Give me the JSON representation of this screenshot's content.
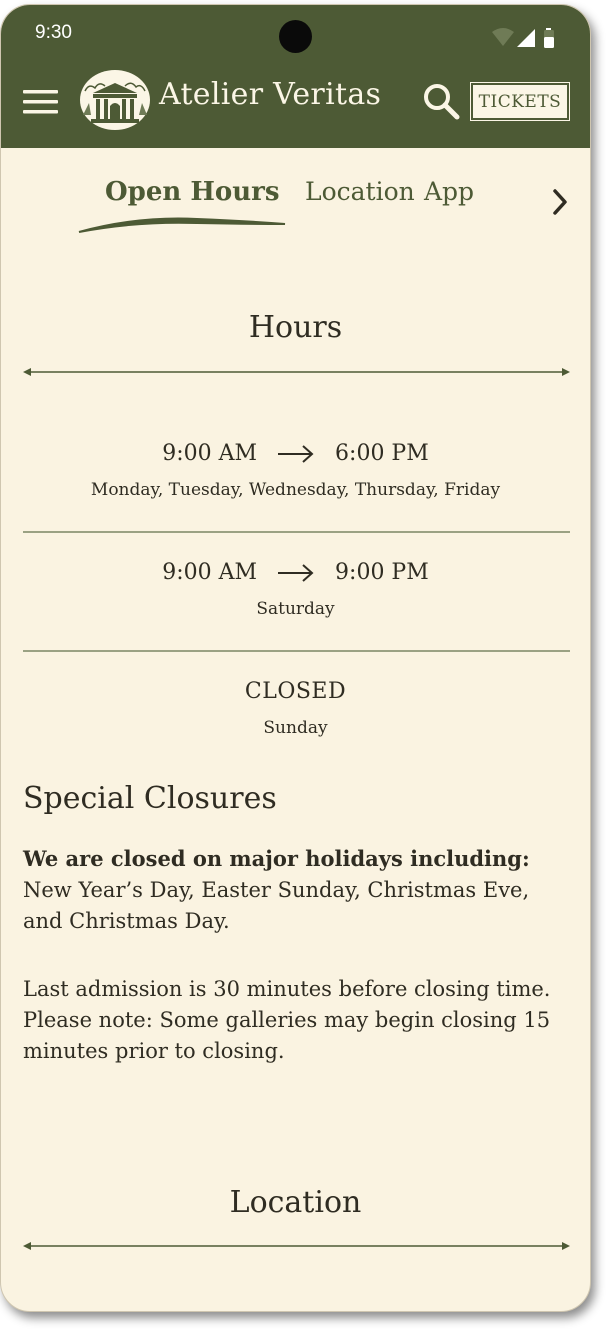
{
  "status_bar": {
    "time": "9:30"
  },
  "header": {
    "brand_name": "Atelier Veritas",
    "tickets_label": "TICKETS"
  },
  "tabs": [
    {
      "label": "Open Hours",
      "active": true
    },
    {
      "label": "Location",
      "active": false
    },
    {
      "label": "App",
      "active": false
    }
  ],
  "hours": {
    "title": "Hours",
    "rows": [
      {
        "open": "9:00 AM",
        "close": "6:00 PM",
        "days": "Monday, Tuesday, Wednesday, Thursday, Friday"
      },
      {
        "open": "9:00 AM",
        "close": "9:00 PM",
        "days": "Saturday"
      },
      {
        "status": "CLOSED",
        "days": "Sunday"
      }
    ]
  },
  "special_closures": {
    "title": "Special Closures",
    "holidays_intro": "We are closed on major holidays including:",
    "holidays_list": "New Year’s Day, Easter Sunday, Christmas Eve, and Christmas Day.",
    "admission_note": "Last admission is 30 minutes before closing time. Please note: Some galleries may begin closing 15 minutes prior to closing."
  },
  "location": {
    "title": "Location"
  },
  "colors": {
    "brand_green": "#4d5a35",
    "cream_background": "#faf3e1",
    "text_dark": "#2f2c22"
  },
  "icons": [
    "menu-icon",
    "museum-logo-icon",
    "search-icon",
    "chevron-right-icon",
    "arrow-right-icon",
    "wifi-icon",
    "signal-icon",
    "battery-icon"
  ]
}
